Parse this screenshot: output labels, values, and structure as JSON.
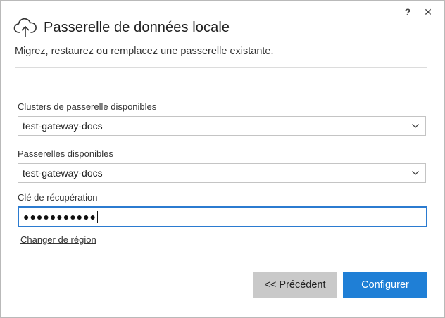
{
  "window": {
    "help_label": "?",
    "close_label": "✕"
  },
  "header": {
    "title": "Passerelle de données locale",
    "subtitle": "Migrez, restaurez ou remplacez une passerelle existante."
  },
  "form": {
    "clusters_label": "Clusters de passerelle disponibles",
    "clusters_value": "test-gateway-docs",
    "gateways_label": "Passerelles disponibles",
    "gateways_value": "test-gateway-docs",
    "recovery_label": "Clé de récupération",
    "recovery_value": "●●●●●●●●●●●"
  },
  "links": {
    "change_region": "Changer de région"
  },
  "buttons": {
    "previous": "<< Précédent",
    "configure": "Configurer"
  },
  "colors": {
    "accent": "#1f7fd6",
    "focus_border": "#2b7bd0",
    "secondary_button": "#c9c9c9"
  },
  "icons": {
    "header": "cloud-upload-icon",
    "dropdown": "chevron-down-icon"
  }
}
